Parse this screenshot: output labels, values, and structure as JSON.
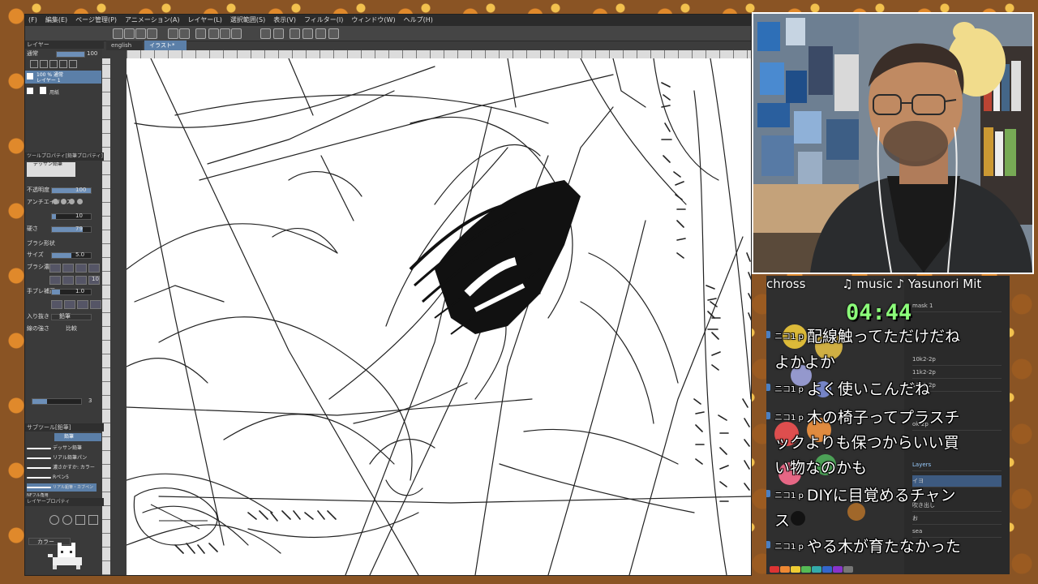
{
  "menu": [
    "(F)",
    "編集(E)",
    "ページ管理(P)",
    "アニメーション(A)",
    "レイヤー(L)",
    "選択範囲(S)",
    "表示(V)",
    "フィルター(I)",
    "ウィンドウ(W)",
    "ヘルプ(H)"
  ],
  "tabs": [
    {
      "label": "english",
      "active": false
    },
    {
      "label": "イラスト*",
      "active": true
    }
  ],
  "left_panel": {
    "layer_title": "レイヤー",
    "blend_mode": "通常",
    "opacity": "100",
    "layer_1": {
      "info": "100 % 通常",
      "name": "レイヤー 1"
    },
    "layer_2": {
      "name": "用紙"
    },
    "tool_property_title": "ツールプロパティ[鉛筆プロパティ]",
    "tool_name": "デッサン鉛筆",
    "rows": [
      {
        "label": "不透明度",
        "value": "100"
      },
      {
        "label": "アンチエイリアス",
        "value": ""
      },
      {
        "label": "",
        "value": "10"
      },
      {
        "label": "硬さ",
        "value": "79"
      },
      {
        "label": "ブラシ形状",
        "value": ""
      },
      {
        "label": "サイズ",
        "value": "5.0"
      },
      {
        "label": "ブラシ濃度",
        "value": ""
      },
      {
        "label": "",
        "value": "10"
      },
      {
        "label": "手ブレ補正",
        "value": "1.0"
      },
      {
        "label": "",
        "value": ""
      },
      {
        "label": "入り抜き",
        "value": "鉛筆"
      },
      {
        "label": "線の強さ",
        "value": "比較"
      }
    ],
    "sub_tool_title": "サブツール[鉛筆]",
    "sub_tool_tab": "鉛筆",
    "brushes": [
      "デッサン鉛筆",
      "リアル鉛筆パン",
      "濃さかすか: カラー",
      "Rペン5",
      "リアル鉛筆・カブペンNFフル角用"
    ],
    "layer_property_title": "レイヤープロパティ",
    "color_label": "カラー",
    "hand_value": "3"
  },
  "overlay": {
    "channel": "chross",
    "music_label": "♫ music ♪",
    "artist": "Yasunori Mit",
    "timer": "04:44",
    "layers_label": "Layers",
    "layer_names": [
      "mask 1",
      "10k2-2p",
      "11k2-2p",
      "12k2-2p",
      "ok-2p",
      "イヨ",
      "吹き出し",
      "お",
      "sea"
    ],
    "colors": {
      "timer": "#8cff7a",
      "pin": "#4a7fc2"
    }
  },
  "chat": [
    {
      "user": "ニコ1 p",
      "line1": "配線触ってただけだね",
      "line2": "よかよか"
    },
    {
      "user": "ニコ1 p",
      "line1": "よく使いこんだね",
      "line2": ""
    },
    {
      "user": "ニコ1 p",
      "line1": "木の椅子ってプラスチ",
      "line2": "ックよりも保つからいい買",
      "line3": "い物なのかも"
    },
    {
      "user": "ニコ1 p",
      "line1": "DIYに目覚めるチャン",
      "line2": "ス"
    },
    {
      "user": "ニコ1 p",
      "line1": "やる木が育たなかった",
      "line2": ""
    }
  ]
}
